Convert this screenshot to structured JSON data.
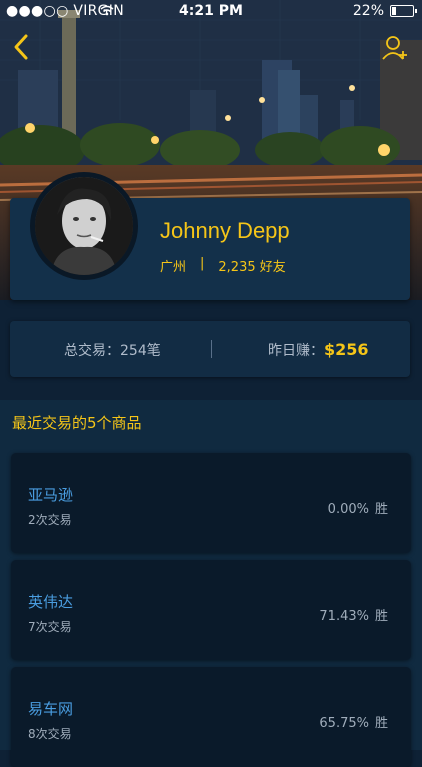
{
  "status_bar": {
    "carrier": "●●●○○ VIRGIN",
    "time": "4:21 PM",
    "battery": "22%",
    "battery_level": 0.22
  },
  "profile": {
    "name": "Johnny Depp",
    "city": "广州",
    "separator": "|",
    "friends": "2,235 好友"
  },
  "stats": {
    "total_label": "总交易：",
    "total_value": "254笔",
    "yesterday_label": "昨日赚：",
    "yesterday_value": "$256"
  },
  "recent": {
    "title": "最近交易的5个商品",
    "items": [
      {
        "name": "亚马逊",
        "count": "2次交易",
        "rate": "0.00%",
        "win": "胜"
      },
      {
        "name": "英伟达",
        "count": "7次交易",
        "rate": "71.43%",
        "win": "胜"
      },
      {
        "name": "易车网",
        "count": "8次交易",
        "rate": "65.75%",
        "win": "胜"
      }
    ]
  },
  "colors": {
    "accent": "#f5c518",
    "link": "#4a9de0",
    "background": "#0e2135"
  },
  "icons": {
    "back": "chevron-left-icon",
    "add_friend": "add-user-icon",
    "wifi": "wifi-icon"
  }
}
